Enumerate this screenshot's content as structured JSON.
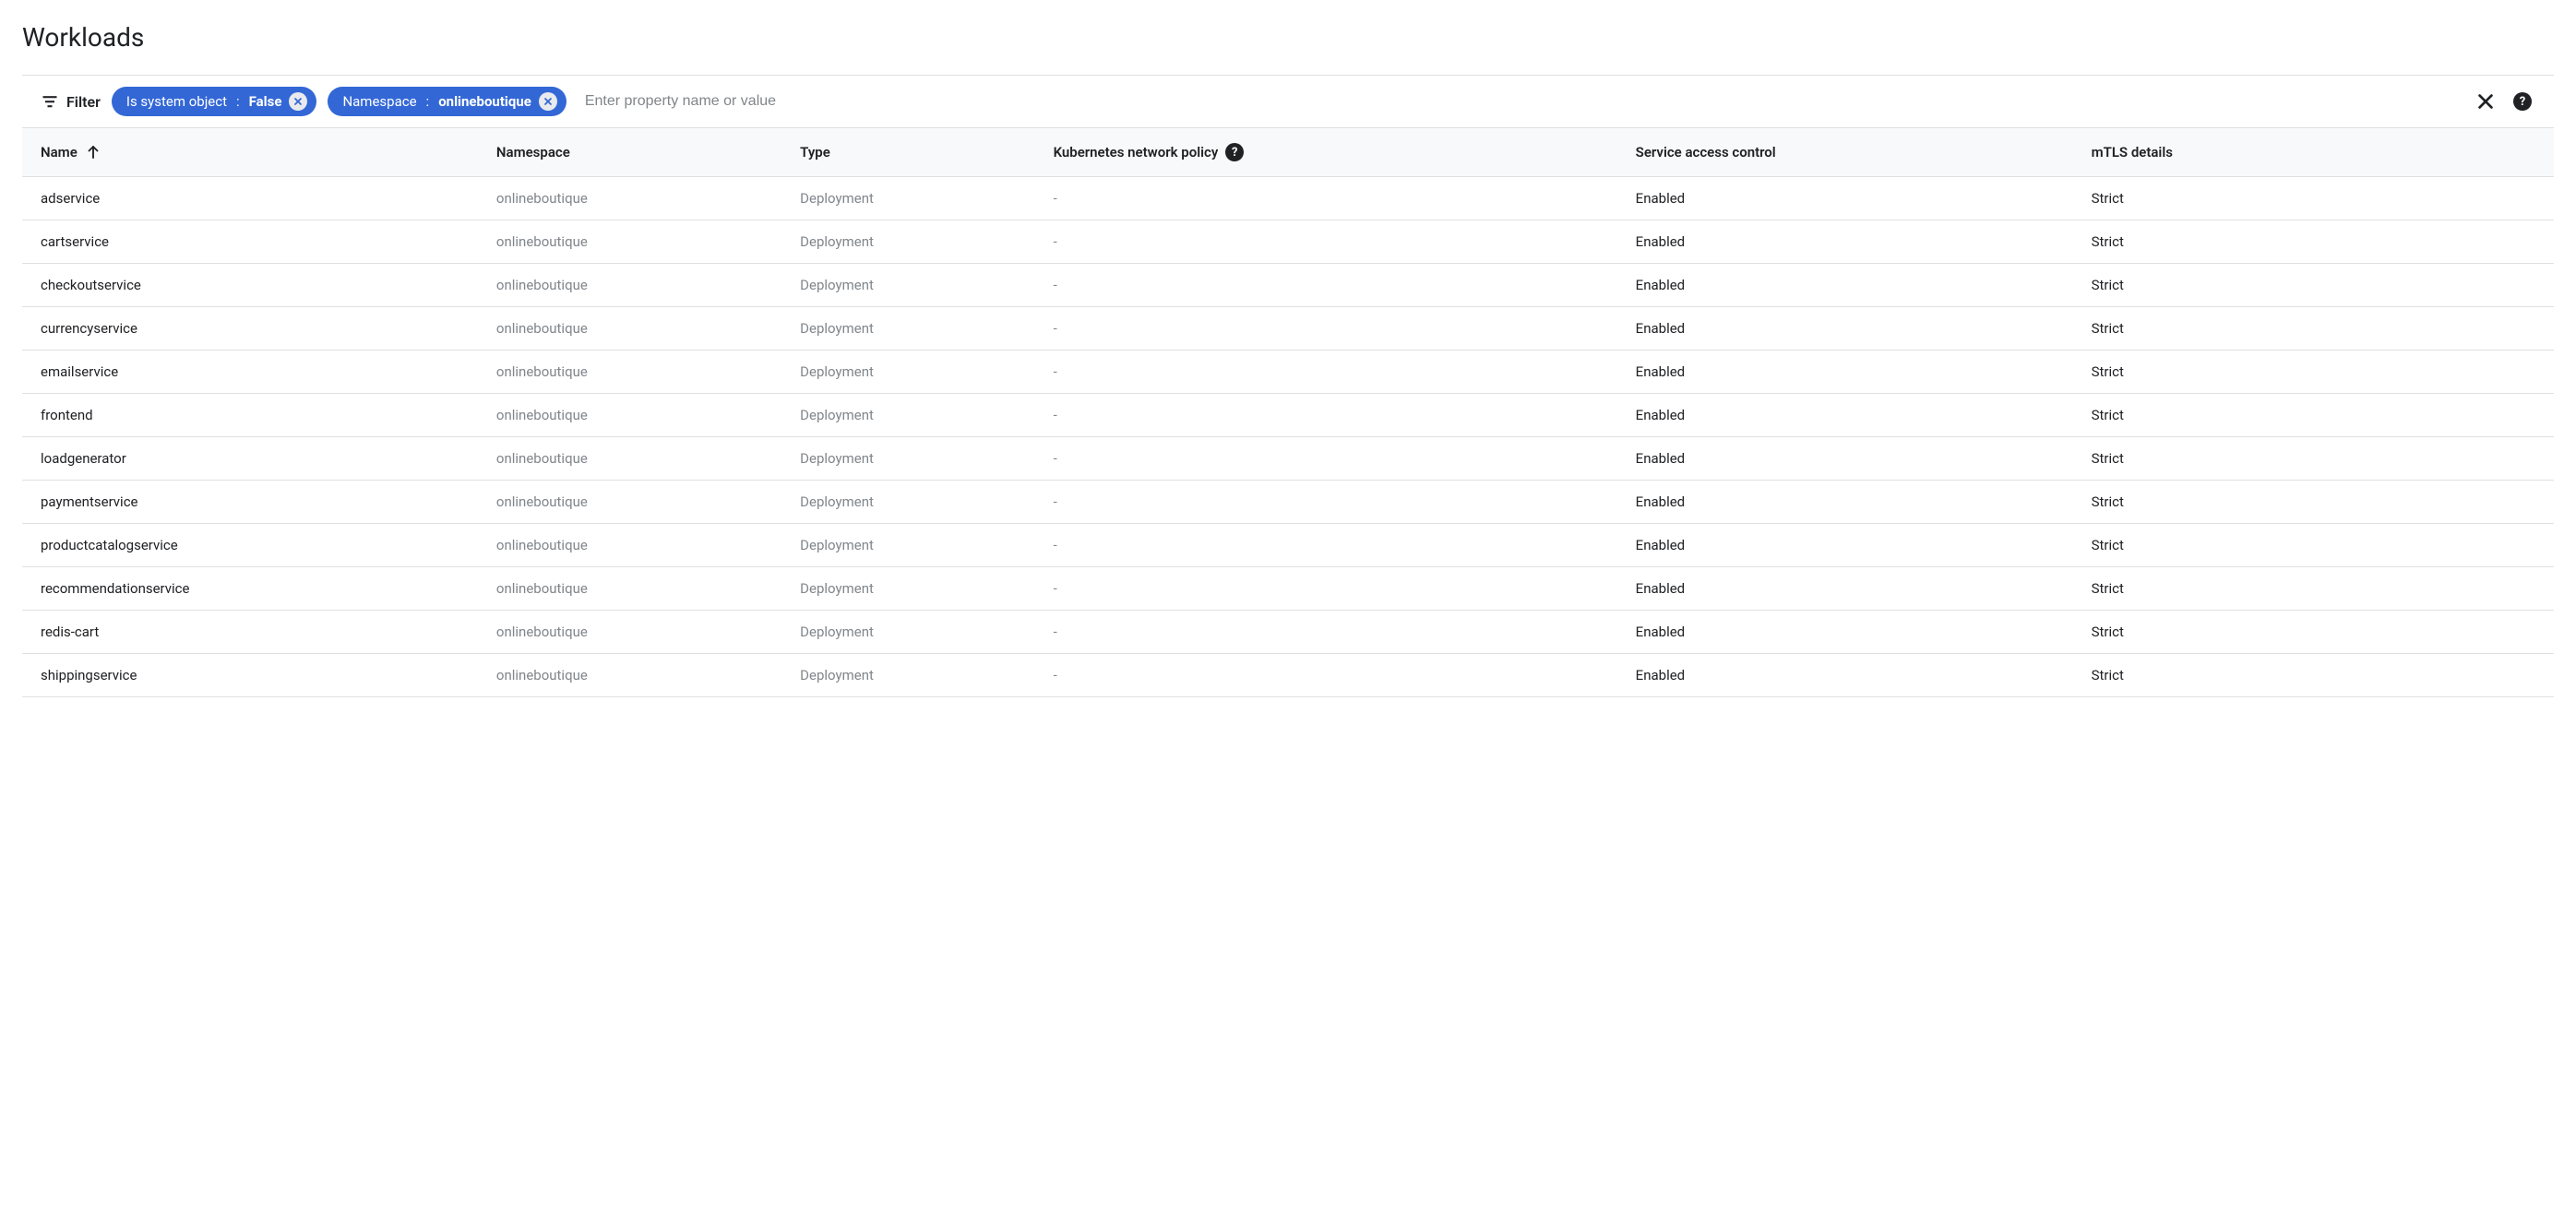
{
  "page": {
    "title": "Workloads"
  },
  "filter": {
    "label": "Filter",
    "chips": [
      {
        "key": "Is system object",
        "value": "False"
      },
      {
        "key": "Namespace",
        "value": "onlineboutique"
      }
    ],
    "placeholder": "Enter property name or value"
  },
  "table": {
    "columns": {
      "name": "Name",
      "namespace": "Namespace",
      "type": "Type",
      "knp": "Kubernetes network policy",
      "sac": "Service access control",
      "mtls": "mTLS details"
    },
    "rows": [
      {
        "name": "adservice",
        "namespace": "onlineboutique",
        "type": "Deployment",
        "knp": "-",
        "sac": "Enabled",
        "mtls": "Strict"
      },
      {
        "name": "cartservice",
        "namespace": "onlineboutique",
        "type": "Deployment",
        "knp": "-",
        "sac": "Enabled",
        "mtls": "Strict"
      },
      {
        "name": "checkoutservice",
        "namespace": "onlineboutique",
        "type": "Deployment",
        "knp": "-",
        "sac": "Enabled",
        "mtls": "Strict"
      },
      {
        "name": "currencyservice",
        "namespace": "onlineboutique",
        "type": "Deployment",
        "knp": "-",
        "sac": "Enabled",
        "mtls": "Strict"
      },
      {
        "name": "emailservice",
        "namespace": "onlineboutique",
        "type": "Deployment",
        "knp": "-",
        "sac": "Enabled",
        "mtls": "Strict"
      },
      {
        "name": "frontend",
        "namespace": "onlineboutique",
        "type": "Deployment",
        "knp": "-",
        "sac": "Enabled",
        "mtls": "Strict"
      },
      {
        "name": "loadgenerator",
        "namespace": "onlineboutique",
        "type": "Deployment",
        "knp": "-",
        "sac": "Enabled",
        "mtls": "Strict"
      },
      {
        "name": "paymentservice",
        "namespace": "onlineboutique",
        "type": "Deployment",
        "knp": "-",
        "sac": "Enabled",
        "mtls": "Strict"
      },
      {
        "name": "productcatalogservice",
        "namespace": "onlineboutique",
        "type": "Deployment",
        "knp": "-",
        "sac": "Enabled",
        "mtls": "Strict"
      },
      {
        "name": "recommendationservice",
        "namespace": "onlineboutique",
        "type": "Deployment",
        "knp": "-",
        "sac": "Enabled",
        "mtls": "Strict"
      },
      {
        "name": "redis-cart",
        "namespace": "onlineboutique",
        "type": "Deployment",
        "knp": "-",
        "sac": "Enabled",
        "mtls": "Strict"
      },
      {
        "name": "shippingservice",
        "namespace": "onlineboutique",
        "type": "Deployment",
        "knp": "-",
        "sac": "Enabled",
        "mtls": "Strict"
      }
    ]
  }
}
